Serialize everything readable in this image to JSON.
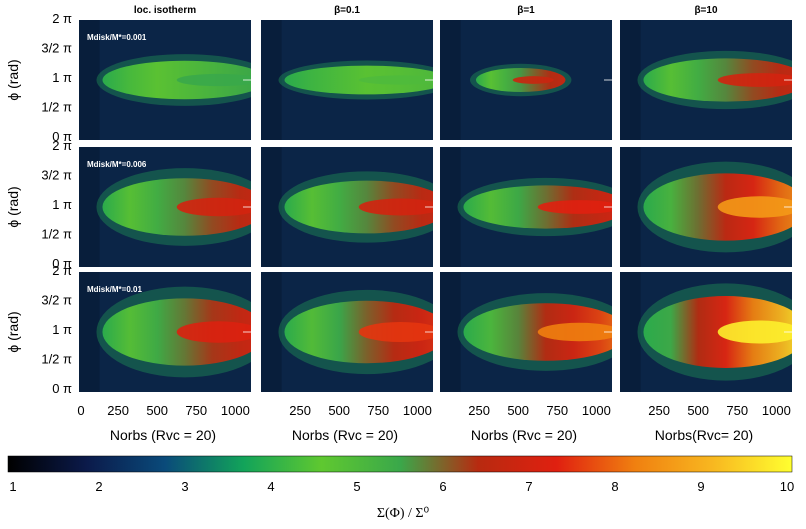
{
  "chart_data": {
    "type": "heatmap",
    "layout": "3 rows x 4 columns",
    "column_titles": [
      "loc. isotherm",
      "β=0.1",
      "β=1",
      "β=10"
    ],
    "row_labels": [
      "Mdisk/M*=0.001",
      "Mdisk/M*=0.006",
      "Mdisk/M*=0.01"
    ],
    "ylabel": "ϕ (rad)",
    "yticks": [
      "2 π",
      "3/2 π",
      "1 π",
      "1/2 π",
      "0 π"
    ],
    "xlabels": [
      "Norbs (Rvc = 20)",
      "Norbs (Rvc = 20)",
      "Norbs (Rvc = 20)",
      "Norbs(Rvc= 20)"
    ],
    "xticks": [
      "0",
      "250",
      "500",
      "750",
      "1000"
    ],
    "xlim": [
      0,
      1100
    ],
    "ylim": [
      0,
      2
    ],
    "colorbar": {
      "label": "Σ(Φ) / Σ⁰",
      "min": 1,
      "max": 10,
      "ticks": [
        "1",
        "2",
        "3",
        "4",
        "5",
        "6",
        "7",
        "8",
        "9",
        "10"
      ],
      "colors": [
        "#000000",
        "#0b1a4a",
        "#0a4a7a",
        "#12a35a",
        "#5fc830",
        "#3aa84a",
        "#b82a10",
        "#e02010",
        "#f08010",
        "#f8b820",
        "#ffff30"
      ]
    },
    "panels": [
      [
        {
          "peak": 5.5,
          "onset": 150,
          "width": 0.16
        },
        {
          "peak": 5.0,
          "onset": 150,
          "width": 0.12
        },
        {
          "peak": 6.8,
          "onset": 230,
          "width": 0.1,
          "end": 700
        },
        {
          "peak": 7.0,
          "onset": 150,
          "width": 0.18
        }
      ],
      [
        {
          "peak": 7.0,
          "onset": 150,
          "width": 0.24
        },
        {
          "peak": 7.0,
          "onset": 150,
          "width": 0.22
        },
        {
          "peak": 7.3,
          "onset": 150,
          "width": 0.18
        },
        {
          "peak": 8.6,
          "onset": 150,
          "width": 0.28
        }
      ],
      [
        {
          "peak": 7.2,
          "onset": 150,
          "width": 0.28
        },
        {
          "peak": 7.5,
          "onset": 150,
          "width": 0.26
        },
        {
          "peak": 8.2,
          "onset": 150,
          "width": 0.24
        },
        {
          "peak": 9.8,
          "onset": 150,
          "width": 0.3
        }
      ]
    ]
  }
}
